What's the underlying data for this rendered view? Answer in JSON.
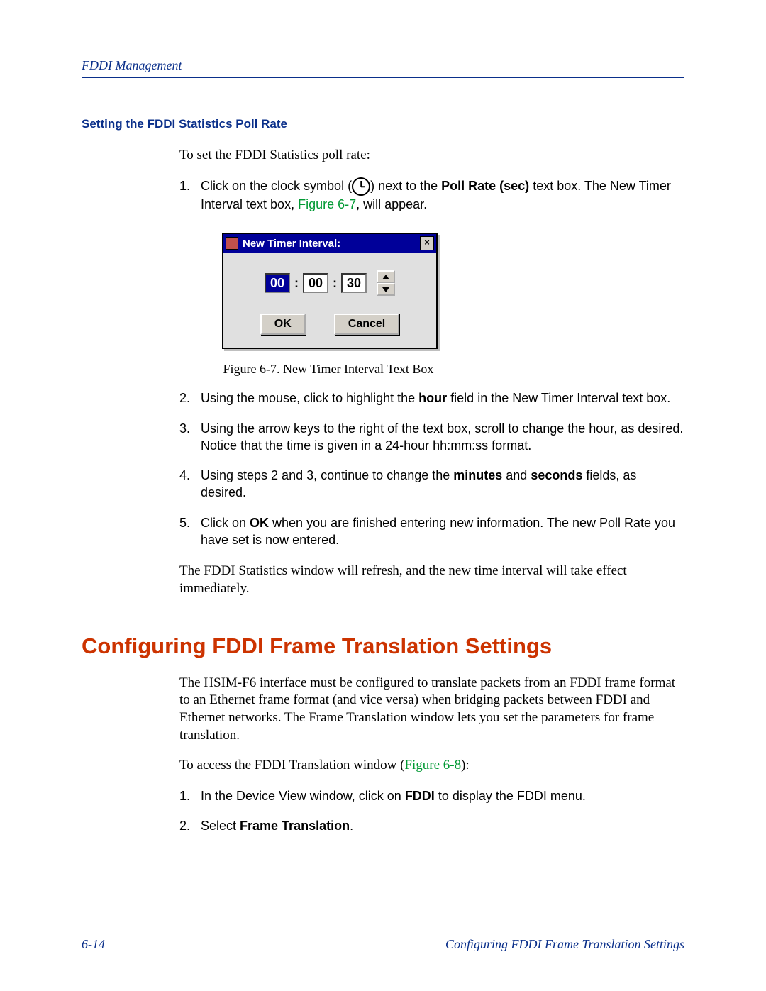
{
  "header": {
    "running": "FDDI Management"
  },
  "section": {
    "subhead": "Setting the FDDI Statistics Poll Rate",
    "intro": "To set the FDDI Statistics poll rate:",
    "steps": {
      "s1a": "Click on the clock symbol (",
      "s1b": ") next to the ",
      "s1c": "Poll Rate (sec)",
      "s1d": " text box. The New Timer Interval text box, ",
      "s1e": "Figure 6-7",
      "s1f": ", will appear.",
      "s2a": "Using the mouse, click to highlight the ",
      "s2b": "hour",
      "s2c": " field in the New Timer Interval text box.",
      "s3": "Using the arrow keys to the right of the text box, scroll to change the hour, as desired. Notice that the time is given in a 24-hour hh:mm:ss format.",
      "s4a": "Using steps 2 and 3, continue to change the ",
      "s4b": "minutes",
      "s4c": " and ",
      "s4d": "seconds",
      "s4e": " fields, as desired.",
      "s5a": "Click on ",
      "s5b": "OK",
      "s5c": " when you are finished entering new information. The new Poll Rate you have set is now entered."
    },
    "after": "The FDDI Statistics window will refresh, and the new time interval will take effect immediately."
  },
  "dialog": {
    "title": "New Timer Interval:",
    "hh": "00",
    "mm": "00",
    "ss": "30",
    "ok": "OK",
    "cancel": "Cancel",
    "caption": "Figure 6-7. New Timer Interval Text Box"
  },
  "heading2": "Configuring FDDI Frame Translation Settings",
  "body2": {
    "p1": "The HSIM-F6 interface must be configured to translate packets from an FDDI frame format to an Ethernet frame format (and vice versa) when bridging packets between FDDI and Ethernet networks. The Frame Translation window lets you set the parameters for frame translation.",
    "p2a": "To access the FDDI Translation window (",
    "p2b": "Figure 6-8",
    "p2c": "):",
    "steps": {
      "s1a": "In the Device View window, click on ",
      "s1b": "FDDI",
      "s1c": " to display the FDDI menu.",
      "s2a": "Select ",
      "s2b": "Frame Translation",
      "s2c": "."
    }
  },
  "footer": {
    "left": "6-14",
    "right": "Configuring FDDI Frame Translation Settings"
  }
}
